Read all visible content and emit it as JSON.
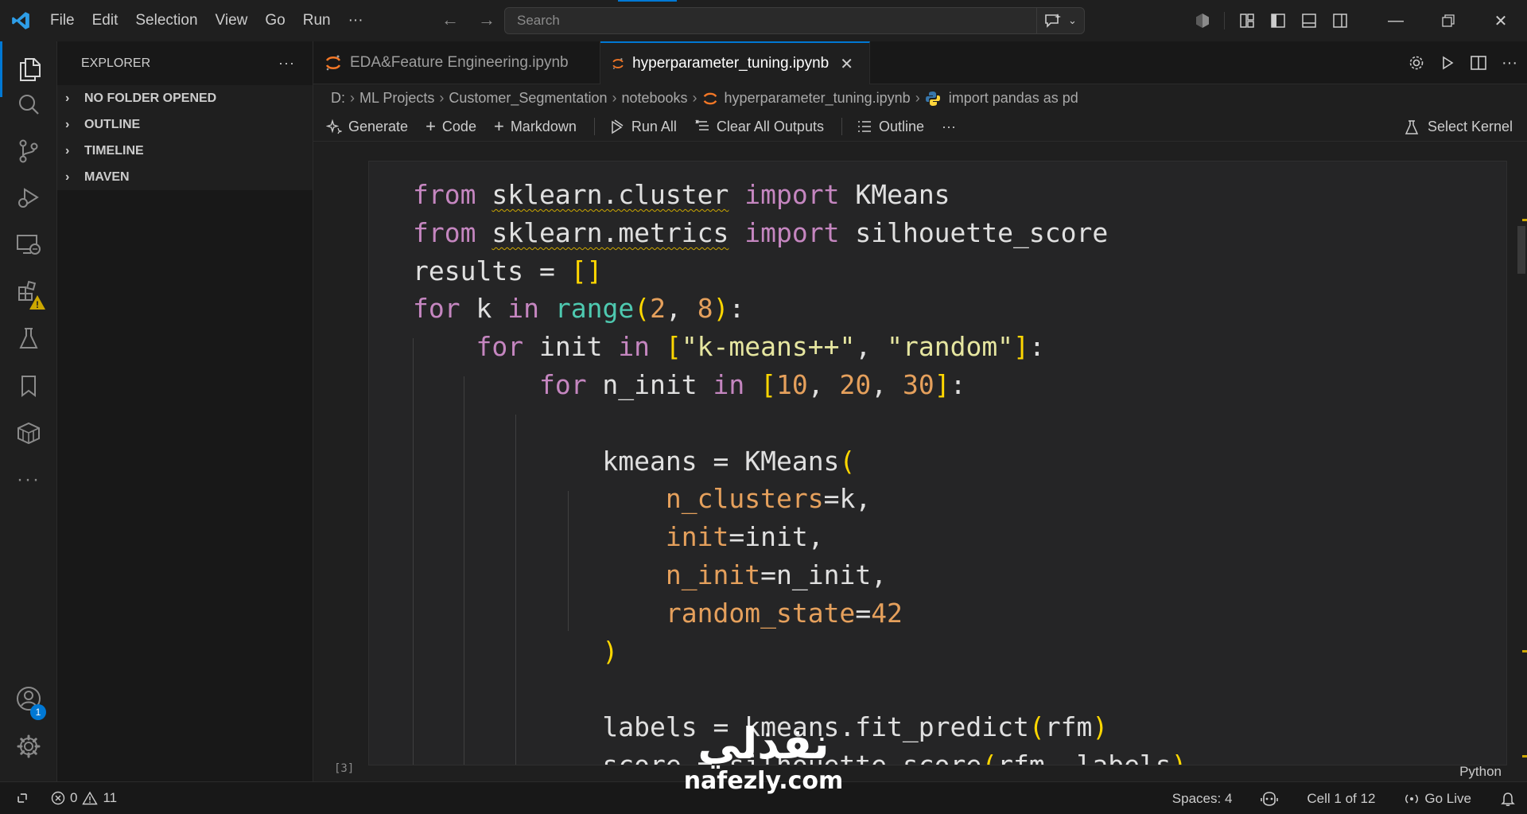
{
  "menu": [
    "File",
    "Edit",
    "Selection",
    "View",
    "Go",
    "Run",
    "···"
  ],
  "search": {
    "placeholder": "Search"
  },
  "sidebar": {
    "title": "EXPLORER",
    "more": "···",
    "sections": [
      "NO FOLDER OPENED",
      "OUTLINE",
      "TIMELINE",
      "MAVEN"
    ]
  },
  "activity_badges": {
    "accounts": "1"
  },
  "tabs": [
    {
      "label": "EDA&Feature Engineering.ipynb",
      "active": false
    },
    {
      "label": "hyperparameter_tuning.ipynb",
      "active": true
    }
  ],
  "breadcrumb": [
    "D:",
    "ML Projects",
    "Customer_Segmentation",
    "notebooks",
    "hyperparameter_tuning.ipynb",
    "import pandas as pd"
  ],
  "notebook_toolbar": {
    "generate": "Generate",
    "code": "Code",
    "markdown": "Markdown",
    "run_all": "Run All",
    "clear_outputs": "Clear All Outputs",
    "outline": "Outline",
    "more": "···",
    "kernel": "Select Kernel"
  },
  "cell": {
    "execution_count": "[3]",
    "language": "Python",
    "code_lines": [
      "from sklearn.cluster import KMeans",
      "from sklearn.metrics import silhouette_score",
      "results = []",
      "for k in range(2, 8):",
      "    for init in [\"k-means++\", \"random\"]:",
      "        for n_init in [10, 20, 30]:",
      "",
      "            kmeans = KMeans(",
      "                n_clusters=k,",
      "                init=init,",
      "                n_init=n_init,",
      "                random_state=42",
      "            )",
      "",
      "            labels = kmeans.fit_predict(rfm)",
      "            score = silhouette_score(rfm, labels)"
    ]
  },
  "statusbar": {
    "errors": "0",
    "warnings": "11",
    "spaces": "Spaces: 4",
    "cell_pos": "Cell 1 of 12",
    "go_live": "Go Live"
  },
  "watermark": {
    "arabic": "نفذلي",
    "latin": "nafezly.com"
  },
  "colors": {
    "accent": "#0078d4",
    "warning": "#cca700",
    "keyword": "#c586c0",
    "number": "#e5a05c"
  }
}
